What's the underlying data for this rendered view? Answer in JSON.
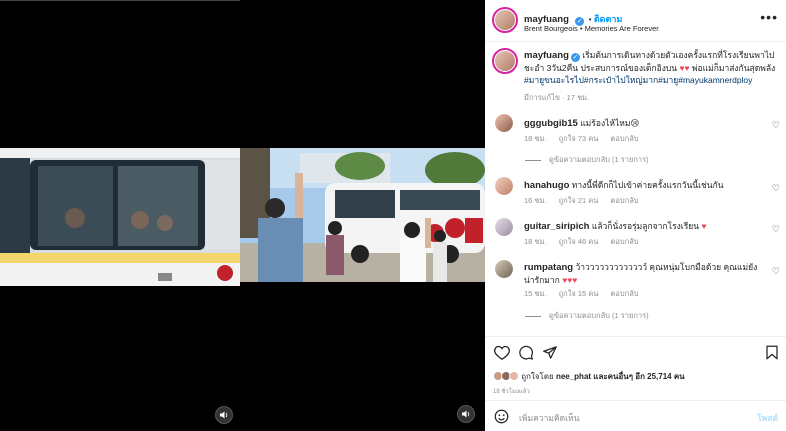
{
  "post": {
    "username": "mayfuang",
    "follow_label": "ติดตาม",
    "subtitle": "Brent Bourgeois • Memories Are Forever",
    "caption_user": "mayfuang",
    "caption_text": "เริ่มต้นการเดินทางด้วยตัวเองครั้งแรกที่โรงเรียนพาไปชะอำ 3วัน2คืน ประสบการณ์ของเด็กอิงบน",
    "caption_text2": "พ่อแม่ก็มาส่งกันสุดพลัง",
    "caption_tags": "#มายูขนอะไรไป#กระเป๋าไปใหญ่มาก#มายู#mayukamnerdploy",
    "caption_time": "มีการแก้ไข · 17 ชม.",
    "more_icon": "more-options-icon"
  },
  "comments": [
    {
      "username": "gggubgib15",
      "text": "แม่ร้องไห้ไหม😢",
      "time": "18 ชม.",
      "likes": "ถูกใจ 73 คน",
      "reply": "ตอบกลับ",
      "view_replies": "ดูข้อความตอบกลับ (1 รายการ)"
    },
    {
      "username": "hanahugo",
      "text": "ทางนี้พี่ดีกก็ไปเข้าค่ายครั้งแรกวันนี้เช่นกัน",
      "time": "16 ชม.",
      "likes": "ถูกใจ 21 คน",
      "reply": "ตอบกลับ"
    },
    {
      "username": "guitar_siripich",
      "text": "แล้วก็นั่งรอรุ่มลูกจากโรงเรียน",
      "time": "18 ชม.",
      "likes": "ถูกใจ 46 คน",
      "reply": "ตอบกลับ"
    },
    {
      "username": "rumpatang",
      "text": "ว้าววววววววววววว์ คุณหนุ่มโบกมือด้วย คุณแม่ยังน่ารักมาก",
      "time": "15 ชม.",
      "likes": "ถูกใจ 15 คน",
      "reply": "ตอบกลับ",
      "view_replies": "ดูข้อความตอบกลับ (1 รายการ)"
    }
  ],
  "footer": {
    "liked_by": "ถูกใจโดย",
    "liked_user": "nee_phat",
    "liked_others": "และคนอื่นๆ อีก 25,714 คน",
    "time": "18 ชั่วโมงแล้ว",
    "add_comment_placeholder": "เพิ่มความคิดเห็น",
    "post_label": "โพสต์"
  },
  "colors": {
    "accent": "#0095f6",
    "heart": "#ed4956",
    "bus_red": "#c0212b"
  }
}
